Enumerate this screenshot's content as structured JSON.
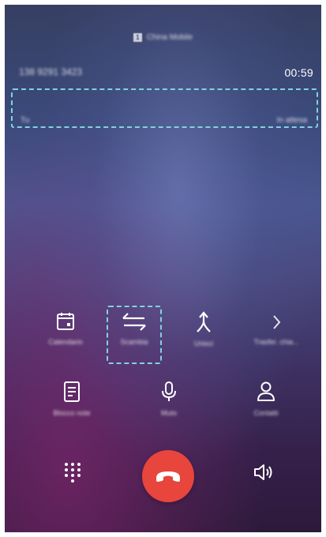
{
  "status": {
    "carrier": "China Mobile",
    "sim_slot": "1"
  },
  "call": {
    "active_number": "138 9291 3423",
    "duration": "00:59",
    "held_name": "Tu",
    "held_status": "In attesa"
  },
  "actions": [
    {
      "label": "Calendario",
      "icon": "calendar-icon"
    },
    {
      "label": "Scambia",
      "icon": "swap-icon"
    },
    {
      "label": "Unisci",
      "icon": "merge-icon"
    },
    {
      "label": "Trasfer. chia...",
      "icon": "chevron-right-icon"
    },
    {
      "label": "Blocco note",
      "icon": "notepad-icon"
    },
    {
      "label": "Muto",
      "icon": "microphone-icon"
    },
    {
      "label": "Contatti",
      "icon": "contact-icon"
    }
  ],
  "bottom_bar": {
    "dialpad_icon": "dialpad-icon",
    "end_call_icon": "hang-up-icon",
    "speaker_icon": "speaker-icon"
  },
  "colors": {
    "highlight": "#7fd3de",
    "end_call": "#e8453c"
  }
}
